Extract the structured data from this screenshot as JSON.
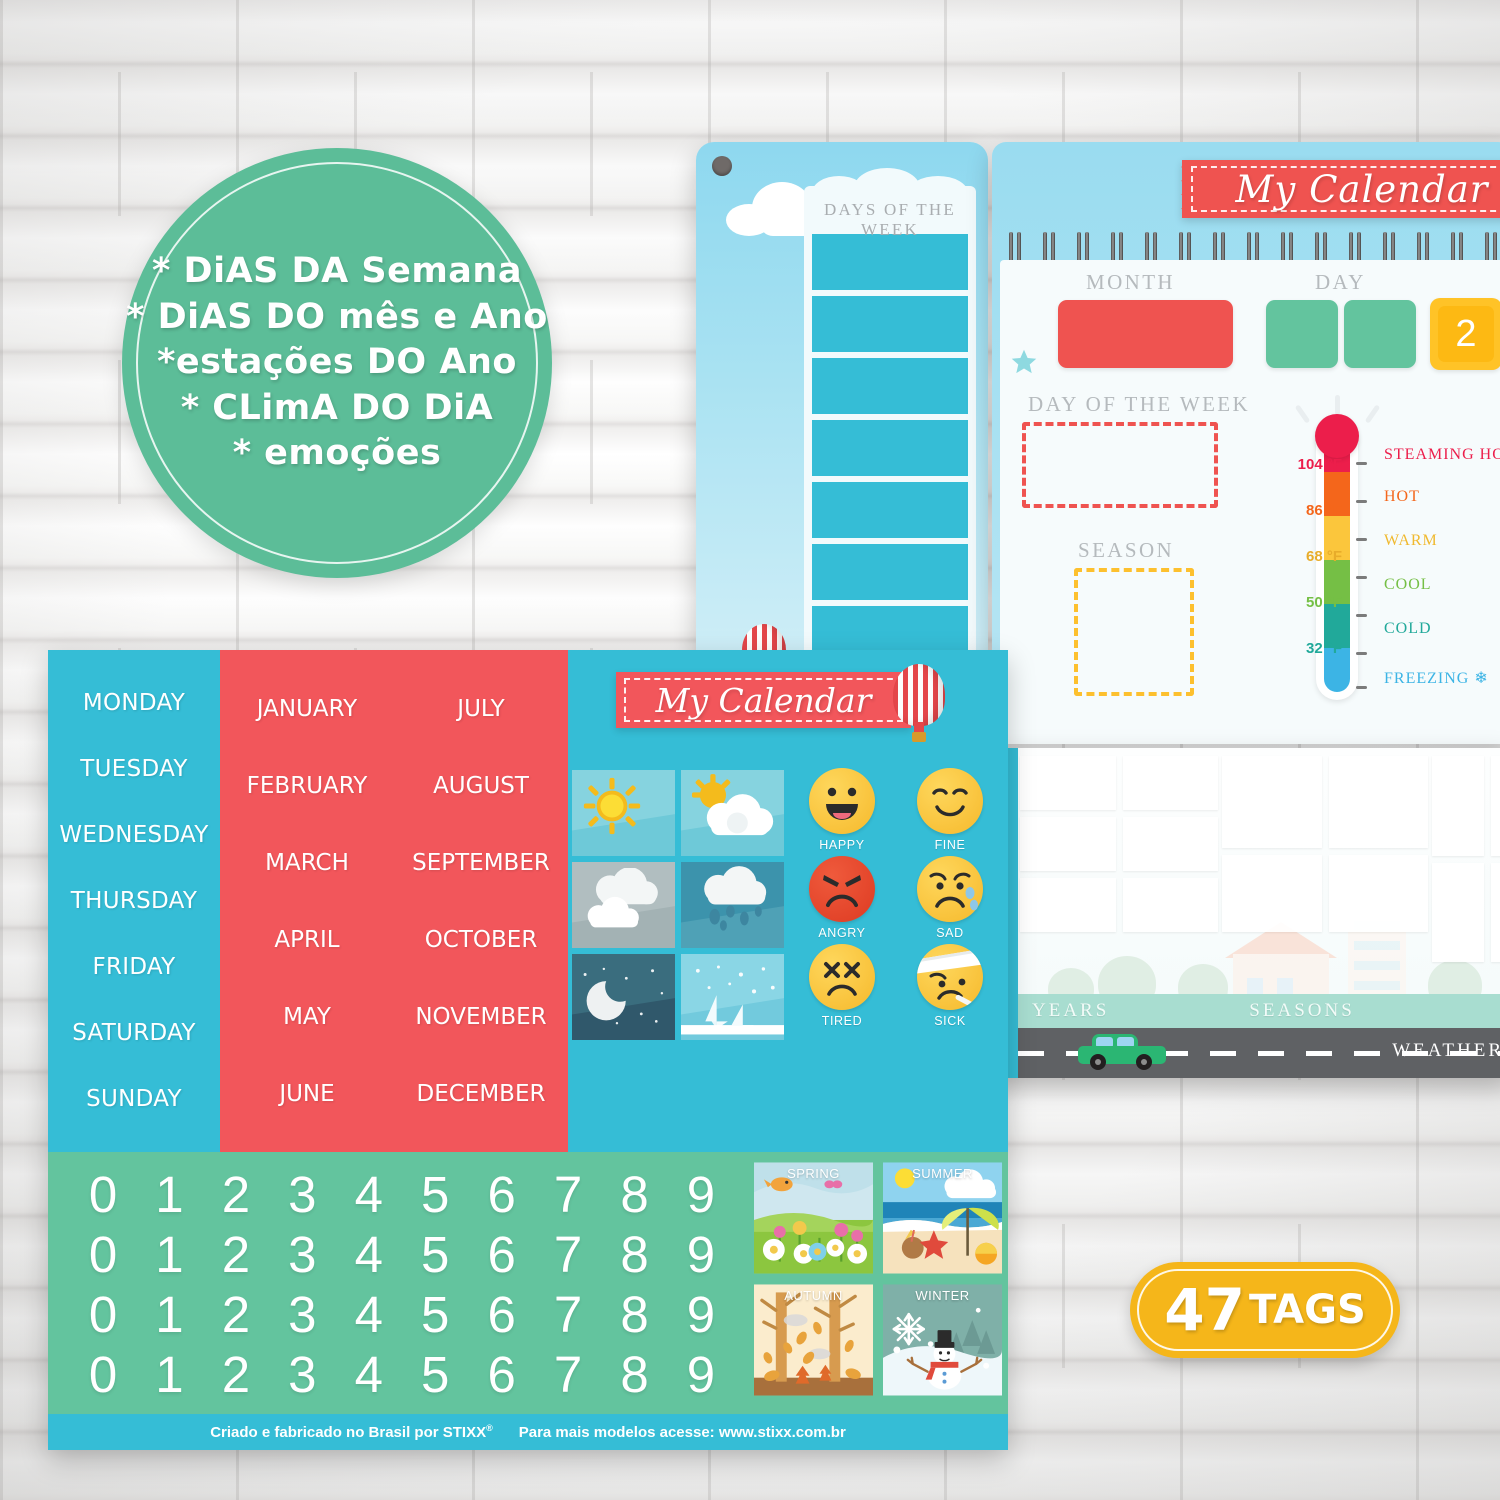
{
  "background": {
    "surface": "white-brick-wall",
    "wall_color": "#f4f3f2"
  },
  "badge": {
    "bg_color": "#5cbd98",
    "lines": [
      "* DiAS DA Semana",
      "* DiAS DO mês e Ano",
      "*estações DO Ano",
      "* CLimA DO DiA",
      "* emoções"
    ]
  },
  "board_week": {
    "title": "DAYS OF THE WEEK",
    "slot_count": 7,
    "slot_color": "#35bdd6",
    "sky_color": "#8ed8ef"
  },
  "board_main": {
    "banner_title": "My Calendar",
    "banner_color": "#ef5350",
    "labels": {
      "month": "MONTH",
      "day": "DAY",
      "day_of_the_week": "DAY OF THE WEEK",
      "season": "SEASON"
    },
    "month_box_color": "#ef5350",
    "day_box_color": "#63c49e",
    "year_tiles": [
      "2",
      ""
    ],
    "year_tile_color": "#fdb913",
    "dow_box_border": "#ef5350",
    "season_box_border": "#fdc02e",
    "spiral_count": 15,
    "thermometer": {
      "scale": [
        {
          "temp": "104 °F",
          "word": "STEAMING HOT",
          "color": "#ec1e4b"
        },
        {
          "temp": "86 °F",
          "word": "HOT",
          "color": "#f4661b"
        },
        {
          "temp": "68 °F",
          "word": "WARM",
          "color": "#fbc63c"
        },
        {
          "temp": "50 °F",
          "word": "COOL",
          "color": "#75bf45"
        },
        {
          "temp": "32 °F",
          "word": "COLD",
          "color": "#21a99a"
        },
        {
          "temp": "",
          "word": "FREEZING ❄",
          "color": "#3cb4e5"
        }
      ]
    }
  },
  "board_chart": {
    "bands": [
      "YEARS",
      "SEASONS",
      "WEATHER"
    ],
    "band_color": "#a8ddd0",
    "road_color": "#5f6164",
    "car_color": "#2bb673"
  },
  "sticker_sheet": {
    "bg_color": "#63c49e",
    "weekdays": [
      "MONDAY",
      "TUESDAY",
      "WEDNESDAY",
      "THURSDAY",
      "FRIDAY",
      "SATURDAY",
      "SUNDAY"
    ],
    "weekday_bg": "#35bdd6",
    "months_left": [
      "JANUARY",
      "FEBRUARY",
      "MARCH",
      "APRIL",
      "MAY",
      "JUNE"
    ],
    "months_right": [
      "JULY",
      "AUGUST",
      "SEPTEMBER",
      "OCTOBER",
      "NOVEMBER",
      "DECEMBER"
    ],
    "months_bg": "#f2565b",
    "banner_title": "My Calendar",
    "weather_tiles": [
      "sunny",
      "partly-cloudy",
      "cloudy",
      "rainy",
      "night",
      "snowy"
    ],
    "emotions": [
      {
        "label": "HAPPY",
        "color": "#fdc739"
      },
      {
        "label": "FINE",
        "color": "#fdc739"
      },
      {
        "label": "ANGRY",
        "color": "#e8452c"
      },
      {
        "label": "SAD",
        "color": "#fdc739"
      },
      {
        "label": "TIRED",
        "color": "#fdc739"
      },
      {
        "label": "SICK",
        "color": "#fdc739"
      }
    ],
    "numbers_rows": [
      [
        "0",
        "1",
        "2",
        "3",
        "4",
        "5",
        "6",
        "7",
        "8",
        "9"
      ],
      [
        "0",
        "1",
        "2",
        "3",
        "4",
        "5",
        "6",
        "7",
        "8",
        "9"
      ],
      [
        "0",
        "1",
        "2",
        "3",
        "4",
        "5",
        "6",
        "7",
        "8",
        "9"
      ],
      [
        "0",
        "1",
        "2",
        "3",
        "4",
        "5",
        "6",
        "7",
        "8",
        "9"
      ]
    ],
    "seasons": [
      {
        "label": "SPRING"
      },
      {
        "label": "SUMMER"
      },
      {
        "label": "AUTUMN"
      },
      {
        "label": "WINTER"
      }
    ],
    "footer_left": "Criado e fabricado no Brasil por STIXX",
    "footer_reg": "®",
    "footer_right": "Para mais modelos acesse: www.stixx.com.br"
  },
  "tags_badge": {
    "count": "47",
    "label": "TAGS",
    "color": "#f5b61a"
  }
}
